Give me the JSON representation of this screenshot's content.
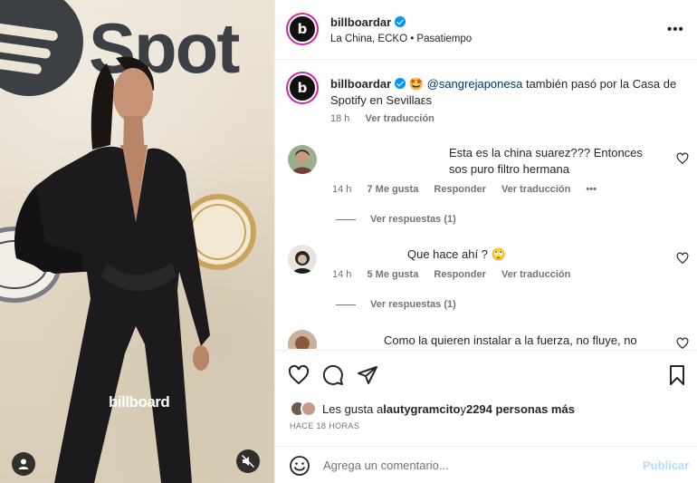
{
  "media": {
    "wall_sign": "Spot",
    "watermark": "billboard"
  },
  "post": {
    "author": "billboardar",
    "location": "La China, ECKO • Pasatiempo",
    "avatar_letter": "b",
    "caption": {
      "author": "billboardar",
      "emoji": "🤩",
      "mention": "@sangrejaponesa",
      "text": " también pasó por la Casa de Spotify en Sevillaεs",
      "time": "18 h",
      "translate": "Ver traducción"
    }
  },
  "comments": [
    {
      "text": "Esta es la china suarez??? Entonces sos puro filtro hermana",
      "time": "14 h",
      "likes": "7 Me gusta",
      "reply": "Responder",
      "translate": "Ver traducción",
      "more": "•••",
      "view_replies": "Ver respuestas (1)"
    },
    {
      "text": "Que hace ahí ? ",
      "emoji": "🙄",
      "time": "14 h",
      "likes": "5 Me gusta",
      "reply": "Responder",
      "translate": "Ver traducción",
      "view_replies": "Ver respuestas (1)"
    },
    {
      "text": "Como la quieren instalar a la fuerza, no fluye, no"
    }
  ],
  "engagement": {
    "liked_prefix": "Les gusta a ",
    "liked_user": "lautygramcito",
    "liked_mid": " y ",
    "liked_count": "2294 personas más",
    "ago": "HACE 18 HORAS"
  },
  "composer": {
    "placeholder": "Agrega un comentario...",
    "publish": "Publicar"
  },
  "icons": {
    "header_more": "more-options-icon",
    "like": "heart-icon",
    "comment": "comment-icon",
    "share": "share-icon",
    "save": "bookmark-icon",
    "emoji": "emoji-icon",
    "mute": "mute-icon",
    "tagged_user": "user-icon"
  },
  "colors": {
    "verified": "#0095f6",
    "publish_disabled": "#b3dbff",
    "story_ring": "#d6249f"
  }
}
